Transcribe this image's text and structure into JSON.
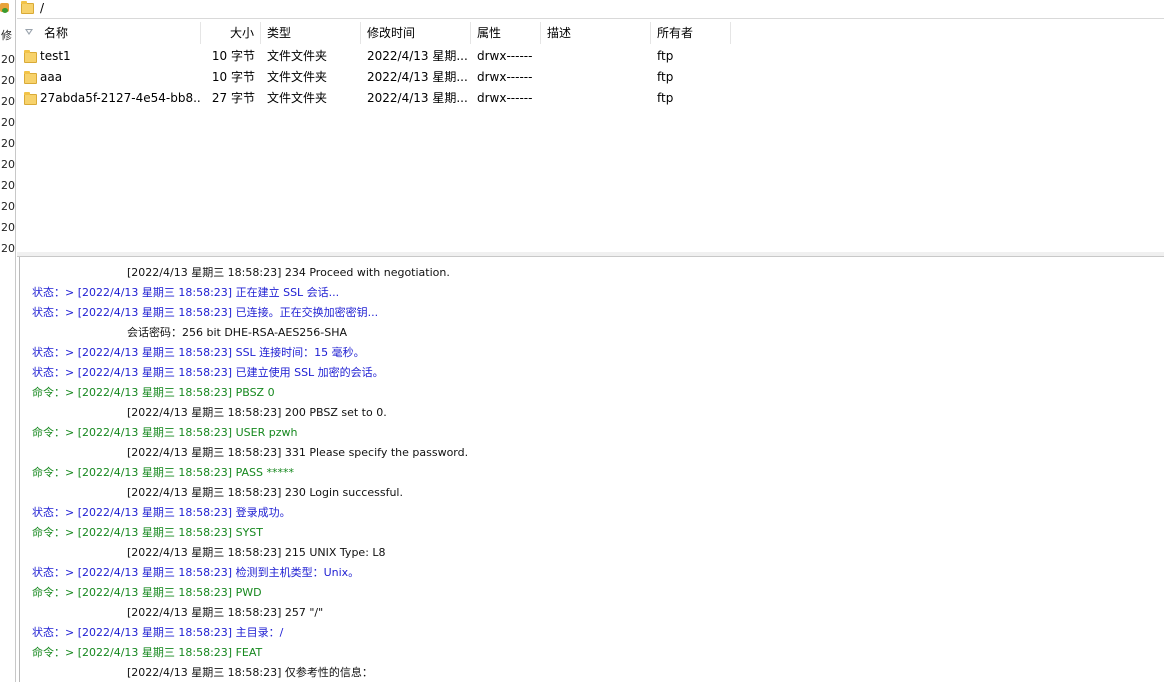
{
  "left_strip": {
    "cells": [
      "修",
      "20",
      "20",
      "20",
      "20",
      "20",
      "20",
      "20",
      "20",
      "20",
      "20"
    ]
  },
  "path_bar": {
    "path": "/"
  },
  "file_list": {
    "columns": [
      {
        "id": "name",
        "label": "名称"
      },
      {
        "id": "size",
        "label": "大小"
      },
      {
        "id": "type",
        "label": "类型"
      },
      {
        "id": "modified",
        "label": "修改时间"
      },
      {
        "id": "perm",
        "label": "属性"
      },
      {
        "id": "desc",
        "label": "描述"
      },
      {
        "id": "owner",
        "label": "所有者"
      }
    ],
    "rows": [
      {
        "name": "test1",
        "size": "10 字节",
        "type": "文件文件夹",
        "modified": "2022/4/13 星期...",
        "perm": "drwx------",
        "desc": "",
        "owner": "ftp"
      },
      {
        "name": "aaa",
        "size": "10 字节",
        "type": "文件文件夹",
        "modified": "2022/4/13 星期...",
        "perm": "drwx------",
        "desc": "",
        "owner": "ftp"
      },
      {
        "name": "27abda5f-2127-4e54-bb8...",
        "size": "27 字节",
        "type": "文件文件夹",
        "modified": "2022/4/13 星期...",
        "perm": "drwx------",
        "desc": "",
        "owner": "ftp"
      }
    ]
  },
  "log": {
    "lines": [
      {
        "kind": "resp",
        "text": "[2022/4/13 星期三 18:58:23] 234 Proceed with negotiation."
      },
      {
        "kind": "status",
        "text": "状态：> [2022/4/13 星期三 18:58:23] 正在建立 SSL 会话..."
      },
      {
        "kind": "status",
        "text": "状态：> [2022/4/13 星期三 18:58:23] 已连接。正在交换加密密钥..."
      },
      {
        "kind": "resp",
        "text": "会话密码：256 bit DHE-RSA-AES256-SHA"
      },
      {
        "kind": "status",
        "text": "状态：> [2022/4/13 星期三 18:58:23] SSL 连接时间：15 毫秒。"
      },
      {
        "kind": "status",
        "text": "状态：> [2022/4/13 星期三 18:58:23] 已建立使用 SSL 加密的会话。"
      },
      {
        "kind": "cmd",
        "text": "命令：> [2022/4/13 星期三 18:58:23] PBSZ 0"
      },
      {
        "kind": "resp",
        "text": "[2022/4/13 星期三 18:58:23] 200 PBSZ set to 0."
      },
      {
        "kind": "cmd",
        "text": "命令：> [2022/4/13 星期三 18:58:23] USER pzwh"
      },
      {
        "kind": "resp",
        "text": "[2022/4/13 星期三 18:58:23] 331 Please specify the password."
      },
      {
        "kind": "cmd",
        "text": "命令：> [2022/4/13 星期三 18:58:23] PASS *****"
      },
      {
        "kind": "resp",
        "text": "[2022/4/13 星期三 18:58:23] 230 Login successful."
      },
      {
        "kind": "status",
        "text": "状态：> [2022/4/13 星期三 18:58:23] 登录成功。"
      },
      {
        "kind": "cmd",
        "text": "命令：> [2022/4/13 星期三 18:58:23] SYST"
      },
      {
        "kind": "resp",
        "text": "[2022/4/13 星期三 18:58:23] 215 UNIX Type: L8"
      },
      {
        "kind": "status",
        "text": "状态：> [2022/4/13 星期三 18:58:23] 检测到主机类型：Unix。"
      },
      {
        "kind": "cmd",
        "text": "命令：> [2022/4/13 星期三 18:58:23] PWD"
      },
      {
        "kind": "resp",
        "text": "[2022/4/13 星期三 18:58:23] 257 \"/\""
      },
      {
        "kind": "status",
        "text": "状态：> [2022/4/13 星期三 18:58:23] 主目录：/"
      },
      {
        "kind": "cmd",
        "text": "命令：> [2022/4/13 星期三 18:58:23] FEAT"
      },
      {
        "kind": "resp",
        "text": "[2022/4/13 星期三 18:58:23] 仅参考性的信息："
      }
    ]
  }
}
